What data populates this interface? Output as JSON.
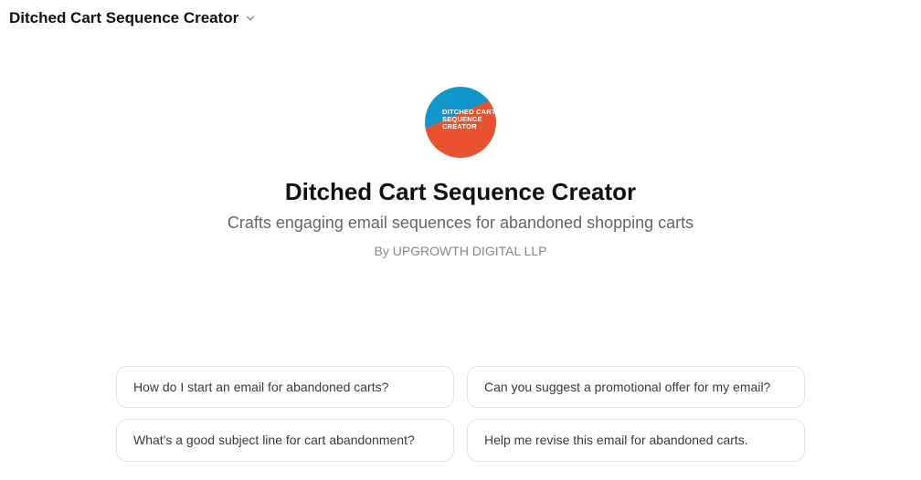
{
  "header": {
    "title": "Ditched Cart Sequence Creator"
  },
  "app": {
    "title": "Ditched Cart Sequence Creator",
    "description": "Crafts engaging email sequences for abandoned shopping carts",
    "byline": "By UPGROWTH DIGITAL LLP",
    "logo_text_lines": [
      "DITCHED CART",
      "SEQUENCE",
      "CREATOR"
    ],
    "logo_colors": {
      "top": "#1196c9",
      "bottom": "#e9532f",
      "text": "#ffffff"
    }
  },
  "prompts": [
    "How do I start an email for abandoned carts?",
    "Can you suggest a promotional offer for my email?",
    "What's a good subject line for cart abandonment?",
    "Help me revise this email for abandoned carts."
  ]
}
